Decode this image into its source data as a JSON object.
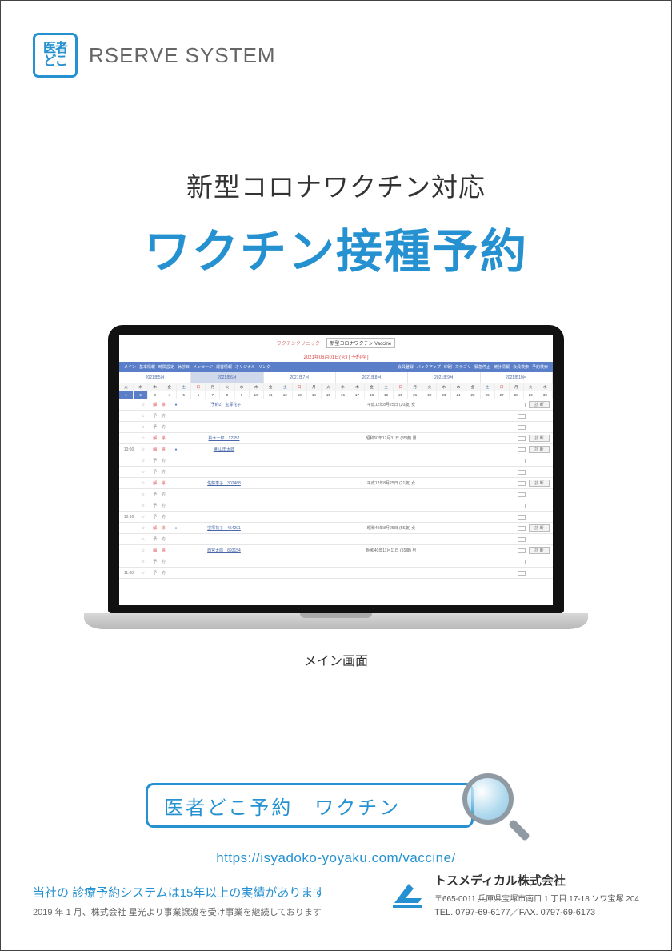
{
  "header": {
    "logo_line1": "医者",
    "logo_line2": "どこ",
    "system_name": "RSERVE SYSTEM"
  },
  "hero": {
    "subtitle": "新型コロナワクチン対応",
    "title": "ワクチン接種予約"
  },
  "laptop": {
    "caption": "メイン画面",
    "app": {
      "clinic": "ワクチンクリニック",
      "selector": "新型コロナワクチン Vaccine",
      "date_line": "2021年06月01日(火) [ 予約枠 ]",
      "nav_left": [
        "メイン",
        "基本情報",
        "時間設定",
        "休診日",
        "メッセージ",
        "運営情報",
        "オリジナル",
        "リンク"
      ],
      "nav_right": [
        "会員登録",
        "バックアップ",
        "印刷",
        "カテゴリ",
        "緊急停止",
        "統計情報",
        "会員検索",
        "予約検索"
      ],
      "months": [
        "2021年5月",
        "2021年6月",
        "2021年7月",
        "2021年8月",
        "2021年9月",
        "2021年10月"
      ],
      "current_month_index": 1,
      "weekdays": [
        "火",
        "水",
        "木",
        "金",
        "土",
        "日",
        "月",
        "火",
        "水",
        "木",
        "金",
        "土",
        "日",
        "月",
        "火",
        "水",
        "木",
        "金",
        "土",
        "日",
        "月",
        "火",
        "水",
        "木",
        "金",
        "土",
        "日",
        "月",
        "火",
        "水"
      ],
      "daynums": [
        "1",
        "2",
        "3",
        "4",
        "5",
        "6",
        "7",
        "8",
        "9",
        "10",
        "11",
        "12",
        "13",
        "14",
        "15",
        "16",
        "17",
        "18",
        "19",
        "20",
        "21",
        "22",
        "23",
        "24",
        "25",
        "26",
        "27",
        "28",
        "29",
        "30"
      ],
      "rows": [
        {
          "time": "",
          "star": "☆",
          "status": "解 除",
          "type": "kai",
          "bullet": "●",
          "name": "（予約2）宝塚花子",
          "info": "平成12年8月25日 (20歳) 女",
          "has_btn": true
        },
        {
          "time": "",
          "star": "☆",
          "status": "予 約",
          "type": "yo",
          "bullet": "",
          "name": "",
          "info": "",
          "has_btn": false
        },
        {
          "time": "",
          "star": "○",
          "status": "予 約",
          "type": "yo",
          "bullet": "",
          "name": "",
          "info": "",
          "has_btn": false
        },
        {
          "time": "",
          "star": "☆",
          "status": "解 除",
          "type": "kai",
          "bullet": "",
          "name": "鈴木一郎　12357",
          "info": "昭和60年12月31日 (35歳) 男",
          "has_btn": true
        },
        {
          "time": "10:00",
          "star": "☆",
          "status": "解 除",
          "type": "kai",
          "bullet": "●",
          "name": "遷 山田太郎",
          "info": "",
          "has_btn": true
        },
        {
          "time": "",
          "star": "☆",
          "status": "予 約",
          "type": "yo",
          "bullet": "",
          "name": "",
          "info": "",
          "has_btn": false
        },
        {
          "time": "",
          "star": "○",
          "status": "予 約",
          "type": "yo",
          "bullet": "",
          "name": "",
          "info": "",
          "has_btn": false
        },
        {
          "time": "",
          "star": "☆",
          "status": "解 除",
          "type": "kai",
          "bullet": "",
          "name": "佐藤恵子　302488",
          "info": "平成12年8月25日 (21歳) 女",
          "has_btn": true
        },
        {
          "time": "",
          "star": "○",
          "status": "予 約",
          "type": "yo",
          "bullet": "",
          "name": "",
          "info": "",
          "has_btn": false
        },
        {
          "time": "",
          "star": "○",
          "status": "予 約",
          "type": "yo",
          "bullet": "",
          "name": "",
          "info": "",
          "has_btn": false
        },
        {
          "time": "10:30",
          "star": "○",
          "status": "予 約",
          "type": "yo",
          "bullet": "",
          "name": "",
          "info": "",
          "has_btn": false
        },
        {
          "time": "",
          "star": "☆",
          "status": "解 除",
          "type": "kai",
          "bullet": "●",
          "name": "宝塚花子　454201",
          "info": "昭和40年8月25日 (55歳) 女",
          "has_btn": true
        },
        {
          "time": "",
          "star": "○",
          "status": "予 約",
          "type": "yo",
          "bullet": "",
          "name": "",
          "info": "",
          "has_btn": false
        },
        {
          "time": "",
          "star": "☆",
          "status": "解 除",
          "type": "kai",
          "bullet": "",
          "name": "西宮太郎　893154",
          "info": "昭和40年11月11日 (55歳) 男",
          "has_btn": true
        },
        {
          "time": "",
          "star": "○",
          "status": "予 約",
          "type": "yo",
          "bullet": "",
          "name": "",
          "info": "",
          "has_btn": false
        },
        {
          "time": "11:00",
          "star": "○",
          "status": "予 約",
          "type": "yo",
          "bullet": "",
          "name": "",
          "info": "",
          "has_btn": false
        }
      ],
      "row_btn_label": "診 断"
    }
  },
  "search": {
    "text": "医者どこ予約　ワクチン",
    "url": "https://isyadoko-yoyaku.com/vaccine/"
  },
  "footer": {
    "left_line1": "当社の 診療予約システムは15年以上の実績があります",
    "left_line2": "2019 年 1 月、株式会社 星光より事業譲渡を受け事業を継続しております",
    "company_name": "トスメディカル株式会社",
    "address": "〒665-0011 兵庫県宝塚市南口 1 丁目 17-18 ソワ宝塚 204",
    "tel_fax": "TEL. 0797-69-6177／FAX. 0797-69-6173"
  }
}
